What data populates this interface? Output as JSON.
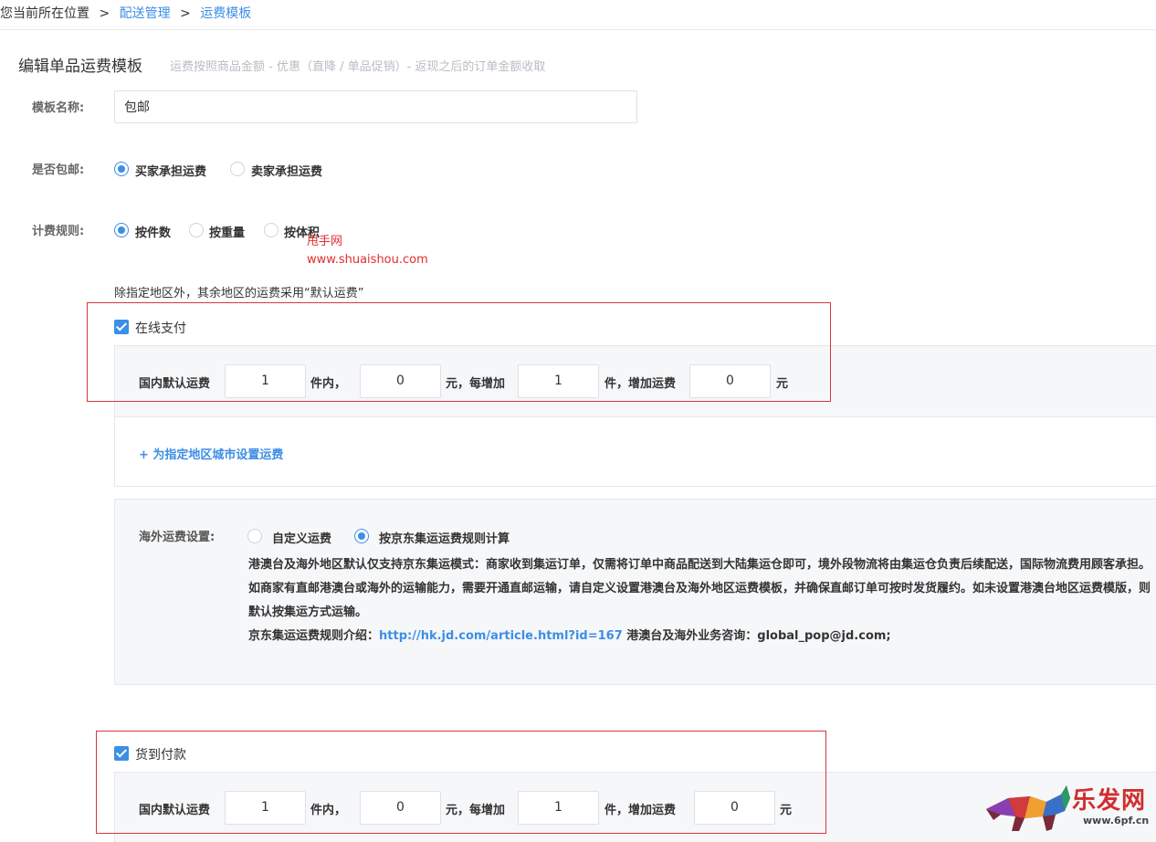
{
  "breadcrumb": {
    "prefix": "您当前所在位置",
    "sep": ">",
    "item1": "配送管理",
    "item2": "运费模板"
  },
  "header": {
    "title": "编辑单品运费模板",
    "subtitle": "运费按照商品金额 - 优惠（直降 / 单品促销）- 返现之后的订单金额收取"
  },
  "form": {
    "name_label": "模板名称:",
    "name_value": "包邮",
    "free_label": "是否包邮:",
    "free_options": [
      "买家承担运费",
      "卖家承担运费"
    ],
    "free_selected": "买家承担运费",
    "rule_label": "计费规则:",
    "rule_options": [
      "按件数",
      "按重量",
      "按体积"
    ],
    "rule_selected": "按件数",
    "default_note": "除指定地区外，其余地区的运费采用“默认运费”"
  },
  "online": {
    "checkbox_label": "在线支付",
    "checked": true,
    "row": {
      "label": "国内默认运费",
      "first_qty": "1",
      "unit1": "件内，",
      "first_fee": "0",
      "unit2": "元，每增加",
      "add_qty": "1",
      "unit3": "件，增加运费",
      "add_fee": "0",
      "unit4": "元"
    },
    "region_link": "+ 为指定地区城市设置运费"
  },
  "overseas": {
    "label": "海外运费设置:",
    "options": [
      "自定义运费",
      "按京东集运运费规则计算"
    ],
    "selected": "按京东集运运费规则计算",
    "para1": "港澳台及海外地区默认仅支持京东集运模式：商家收到集运订单，仅需将订单中商品配送到大陆集运仓即可，境外段物流将由集运仓负责后续配送，国际物流费用顾客承担。",
    "para2": "如商家有直邮港澳台或海外的运输能力，需要开通直邮运输，请自定义设置港澳台及海外地区运费模板，并确保直邮订单可按时发货履约。如未设置港澳台地区运费模版，则默认按集运方式运输。",
    "para3_prefix": "京东集运运费规则介绍：",
    "para3_link": "http://hk.jd.com/article.html?id=167",
    "para3_suffix": " 港澳台及海外业务咨询：global_pop@jd.com;"
  },
  "cod": {
    "checkbox_label": "货到付款",
    "checked": true,
    "row": {
      "label": "国内默认运费",
      "first_qty": "1",
      "unit1": "件内，",
      "first_fee": "0",
      "unit2": "元，每增加",
      "add_qty": "1",
      "unit3": "件，增加运费",
      "add_fee": "0",
      "unit4": "元"
    }
  },
  "watermark": {
    "line1": "甩手网",
    "line2": "www.shuaishou.com",
    "logo_text": "乐发网",
    "logo_url": "www.6pf.cn"
  },
  "colors": {
    "accent": "#3d8ee6",
    "highlight_box": "#d9363e",
    "panel_bg": "#f6f7f9"
  }
}
